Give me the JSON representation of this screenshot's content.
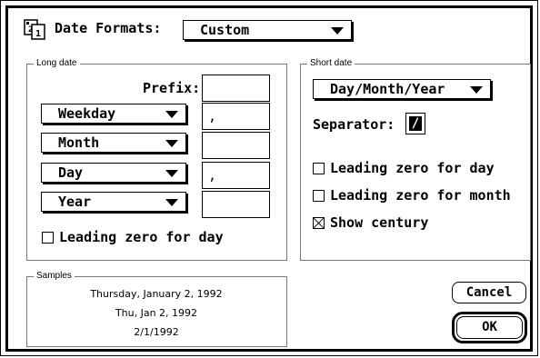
{
  "dialog": {
    "title_label": "Date Formats:",
    "format_popup_value": "Custom"
  },
  "long_date": {
    "group_title": "Long date",
    "prefix_label": "Prefix:",
    "prefix_value": "",
    "rows": [
      {
        "popup": "Weekday",
        "separator": ","
      },
      {
        "popup": "Month",
        "separator": ""
      },
      {
        "popup": "Day",
        "separator": ","
      },
      {
        "popup": "Year",
        "separator": ""
      }
    ],
    "leading_zero_label": "Leading zero for day",
    "leading_zero_checked": false
  },
  "short_date": {
    "group_title": "Short date",
    "order_popup_value": "Day/Month/Year",
    "separator_label": "Separator:",
    "separator_value": "/",
    "leading_zero_day_label": "Leading zero for day",
    "leading_zero_day_checked": false,
    "leading_zero_month_label": "Leading zero for month",
    "leading_zero_month_checked": false,
    "show_century_label": "Show century",
    "show_century_checked": true
  },
  "samples": {
    "group_title": "Samples",
    "lines": [
      "Thursday, January 2, 1992",
      "Thu, Jan 2, 1992",
      "2/1/1992"
    ]
  },
  "buttons": {
    "cancel_label": "Cancel",
    "ok_label": "OK"
  },
  "icons": {
    "dialog_icon": "calendar-icon",
    "popup_arrow": "triangle-down-icon",
    "checkbox_checked": "x-check-icon"
  }
}
